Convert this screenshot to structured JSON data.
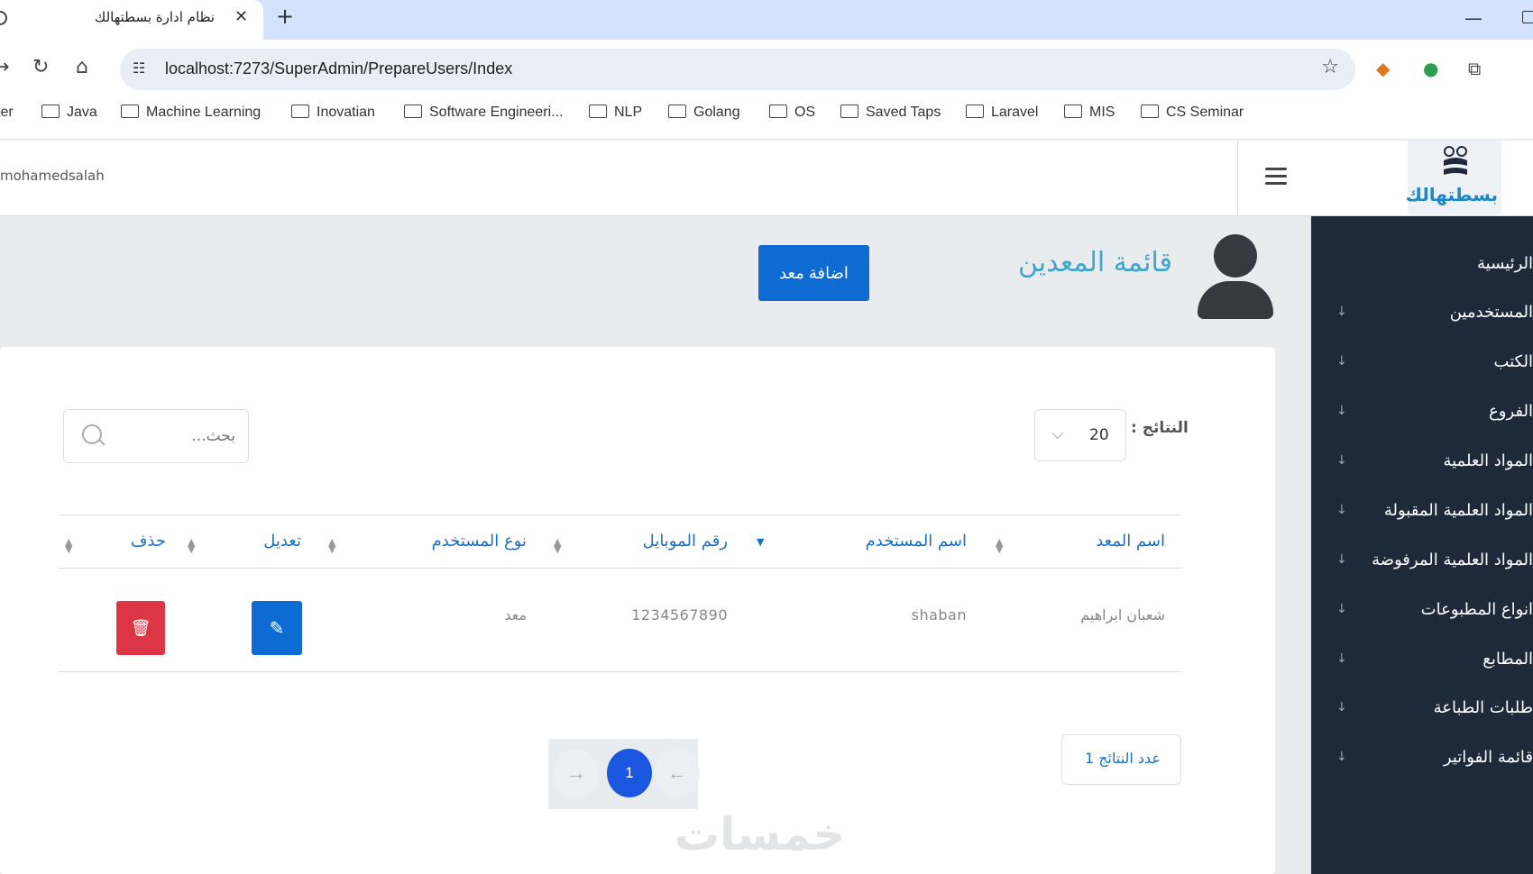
{
  "browser": {
    "tab_title": "نظام ادارة بسطتهالك",
    "url": "localhost:7273/SuperAdmin/PrepareUsers/Index",
    "bookmarks": [
      "ter",
      "Java",
      "Machine Learning",
      "Inovatian",
      "Software Engineeri...",
      "NLP",
      "Golang",
      "OS",
      "Saved Taps",
      "Laravel",
      "MIS",
      "CS Seminar"
    ]
  },
  "header": {
    "username": "mohamedsalah",
    "logo_text": "بسطتهالك"
  },
  "sidebar": {
    "items": [
      {
        "label": "الرئيسية"
      },
      {
        "label": "المستخدمين"
      },
      {
        "label": "الكتب"
      },
      {
        "label": "الفروع"
      },
      {
        "label": "المواد العلمية"
      },
      {
        "label": "المواد العلمية المقبولة"
      },
      {
        "label": "المواد العلمية المرفوضة"
      },
      {
        "label": "انواع المطبوعات"
      },
      {
        "label": "المطابع"
      },
      {
        "label": "طلبات الطباعة"
      },
      {
        "label": "قائمة الفواتير"
      }
    ]
  },
  "main": {
    "title": "قائمة المعدين",
    "add_button": "اضافة معد",
    "results_label": "النتائج :",
    "results_value": "20",
    "search_placeholder": "بحث...",
    "columns": [
      "اسم المعد",
      "اسم المستخدم",
      "رقم الموبايل",
      "نوع المستخدم",
      "تعديل",
      "حذف"
    ],
    "rows": [
      {
        "name": "شعبان ابراهيم",
        "username": "shaban",
        "mobile": "1234567890",
        "type": "معد"
      }
    ],
    "results_count": "عدد النتائج 1",
    "current_page": "1",
    "watermark": "خمسات"
  }
}
